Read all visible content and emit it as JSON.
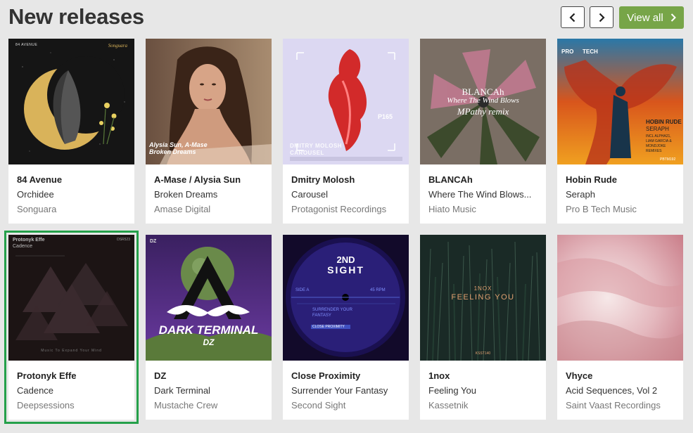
{
  "header": {
    "title": "New releases",
    "prev_icon": "chevron-left-icon",
    "next_icon": "chevron-right-icon",
    "view_all_label": "View all"
  },
  "colors": {
    "background": "#e7e7e7",
    "accent": "#77a548",
    "selected_outline": "#25a04a"
  },
  "releases": [
    {
      "artist": "84 Avenue",
      "title": "Orchidee",
      "label": "Songuara",
      "cover_text": [
        "84 AVENUE",
        "Songuara"
      ]
    },
    {
      "artist": "A-Mase / Alysia Sun",
      "title": "Broken Dreams",
      "label": "Amase Digital",
      "cover_text": [
        "Alysia Sun, A-Mase",
        "Broken Dreams"
      ]
    },
    {
      "artist": "Dmitry Molosh",
      "title": "Carousel",
      "label": "Protagonist Recordings",
      "cover_text": [
        "DMITRY MOLOSH",
        "CAROUSEL",
        "P165"
      ]
    },
    {
      "artist": "BLANCAh",
      "title": "Where The Wind Blows...",
      "label": "Hiato Music",
      "cover_text": [
        "BLANCAh",
        "Where The Wind Blows",
        "MPathy remix"
      ]
    },
    {
      "artist": "Hobin Rude",
      "title": "Seraph",
      "label": "Pro B Tech Music",
      "cover_text": [
        "PRO",
        "TECH",
        "HOBIN RUDE",
        "SERAPH",
        "INCL ALPHA21,",
        "LIAM GARCIA &",
        "MONDJOKE",
        "REMIXES",
        "PBTM192"
      ]
    },
    {
      "artist": "Protonyk Effe",
      "title": "Cadence",
      "label": "Deepsessions",
      "selected": true,
      "cover_text": [
        "Protonyk Effe",
        "Cadence",
        "DSR523",
        "Music To Expand Your Mind"
      ]
    },
    {
      "artist": "DZ",
      "title": "Dark Terminal",
      "label": "Mustache Crew",
      "cover_text": [
        "DZ",
        "DARK TERMINAL",
        "DZ"
      ]
    },
    {
      "artist": "Close Proximity",
      "title": "Surrender Your Fantasy",
      "label": "Second Sight",
      "cover_text": [
        "2ND",
        "SIGHT",
        "SIDE A",
        "45 RPM",
        "SURRENDER YOUR",
        "FANTASY",
        "CLOSE PROXIMITY"
      ]
    },
    {
      "artist": "1nox",
      "title": "Feeling You",
      "label": "Kassetnik",
      "cover_text": [
        "1NOX",
        "FEELING YOU",
        "KSST140"
      ]
    },
    {
      "artist": "Vhyce",
      "title": "Acid Sequences, Vol 2",
      "label": "Saint Vaast Recordings",
      "cover_text": []
    }
  ]
}
